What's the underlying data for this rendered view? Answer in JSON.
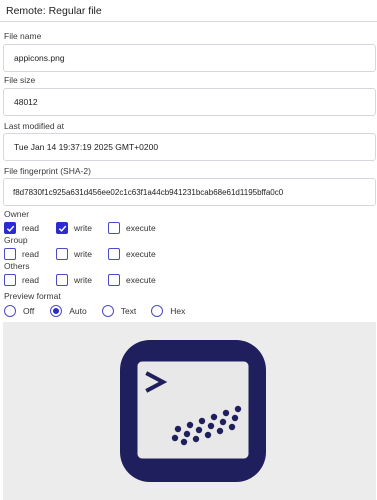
{
  "header": {
    "title": "Remote: Regular file"
  },
  "fields": {
    "file_name": {
      "label": "File name",
      "value": "appicons.png"
    },
    "file_size": {
      "label": "File size",
      "value": "48012"
    },
    "last_modified": {
      "label": "Last modified at",
      "value": "Tue Jan 14 19:37:19 2025 GMT+0200"
    },
    "fingerprint": {
      "label": "File fingerprint (SHA-2)",
      "value": "f8d7830f1c925a631d456ee02c1c63f1a44cb941231bcab68e61d1195bffa0c0"
    }
  },
  "permissions": {
    "owner": {
      "label": "Owner",
      "read": true,
      "write": true,
      "execute": false
    },
    "group": {
      "label": "Group",
      "read": false,
      "write": false,
      "execute": false
    },
    "others": {
      "label": "Others",
      "read": false,
      "write": false,
      "execute": false
    },
    "labels": {
      "read": "read",
      "write": "write",
      "execute": "execute"
    }
  },
  "preview_format": {
    "label": "Preview format",
    "options": [
      "Off",
      "Auto",
      "Text",
      "Hex"
    ],
    "selected": "Auto"
  },
  "preview_image": {
    "icon": "terminal-app-icon",
    "background": "#1f1f5e",
    "screen": "#e8e8e8"
  }
}
